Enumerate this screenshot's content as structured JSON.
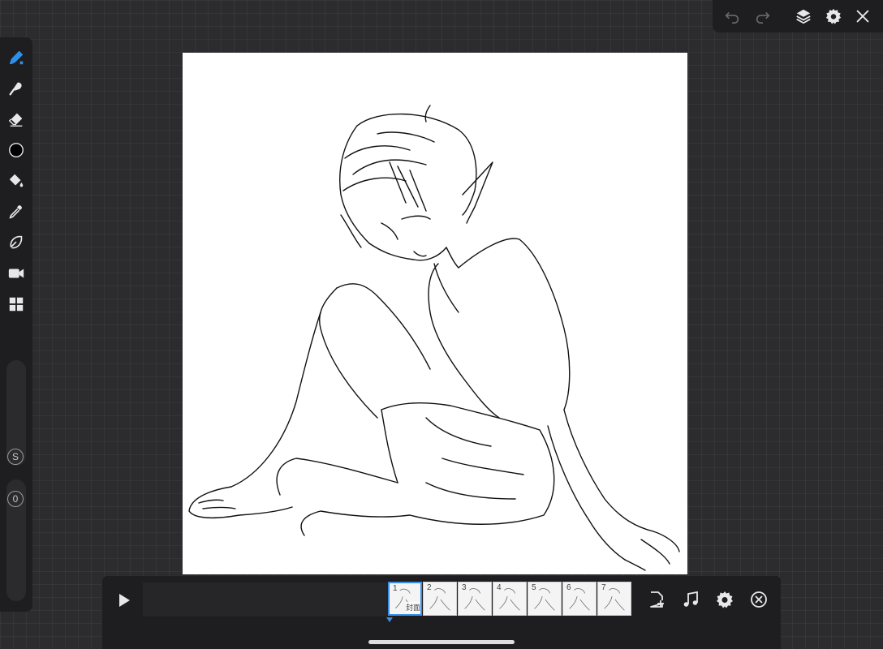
{
  "toolbar_left": {
    "tools": [
      {
        "name": "pen-tool",
        "icon": "pen-icon",
        "active": true
      },
      {
        "name": "brush-tool",
        "icon": "brush-icon"
      },
      {
        "name": "eraser-tool",
        "icon": "eraser-icon"
      },
      {
        "name": "color-picker",
        "icon": "color-swatch-icon"
      },
      {
        "name": "fill-tool",
        "icon": "paint-bucket-icon"
      },
      {
        "name": "eyedropper-tool",
        "icon": "eyedropper-icon"
      },
      {
        "name": "lasso-tool",
        "icon": "lasso-icon"
      },
      {
        "name": "camera-tool",
        "icon": "video-camera-icon"
      },
      {
        "name": "grid-tool",
        "icon": "grid-icon"
      }
    ],
    "size_badge": "S",
    "opacity_badge": "0"
  },
  "toolbar_top": {
    "buttons": [
      "undo-icon",
      "redo-icon",
      "layers-icon",
      "gear-icon",
      "close-icon"
    ]
  },
  "timeline": {
    "frames": [
      {
        "number": "1",
        "label": "封面",
        "selected": true
      },
      {
        "number": "2"
      },
      {
        "number": "3"
      },
      {
        "number": "4"
      },
      {
        "number": "5"
      },
      {
        "number": "6"
      },
      {
        "number": "7"
      }
    ],
    "buttons": [
      "add-frame-icon",
      "music-icon",
      "gear-icon",
      "close-circle-icon"
    ]
  },
  "colors": {
    "accent": "#3b8fe8",
    "panel": "#1e1e20",
    "background": "#2c2c2e",
    "canvas": "#ffffff"
  }
}
